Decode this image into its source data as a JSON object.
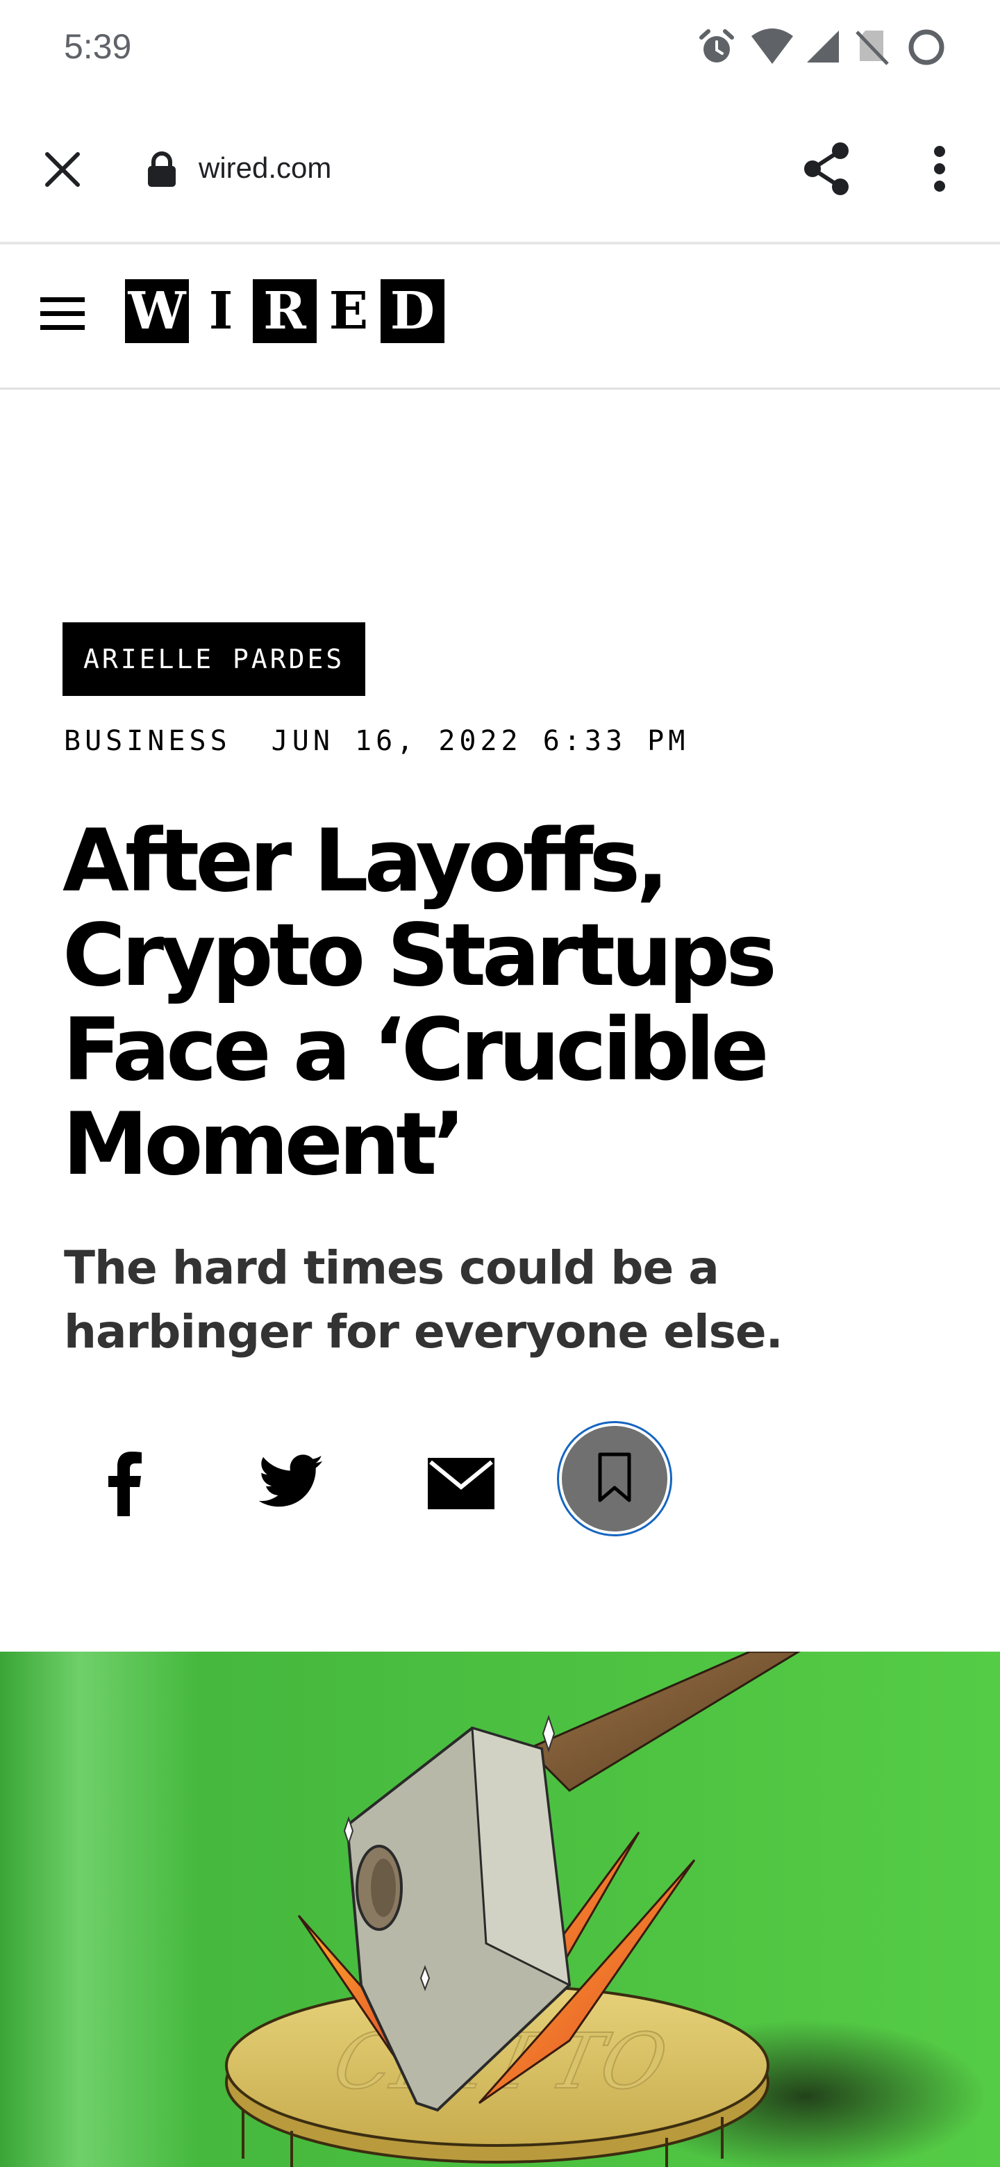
{
  "status_bar": {
    "time": "5:39",
    "icons": [
      "alarm-icon",
      "wifi-icon",
      "signal-icon",
      "no-sim-icon",
      "loading-circle-icon"
    ]
  },
  "browser": {
    "url": "wired.com",
    "icons": [
      "close-icon",
      "lock-icon",
      "share-icon",
      "more-vert-icon"
    ]
  },
  "site_nav": {
    "menu_icon": "hamburger-menu-icon",
    "logo_letters": [
      "W",
      "I",
      "R",
      "E",
      "D"
    ]
  },
  "article": {
    "author": "ARIELLE PARDES",
    "section": "BUSINESS",
    "date": "JUN 16, 2022 6:33 PM",
    "headline": "After Layoffs, Crypto Startups Face a ‘Crucible Moment’",
    "dek": "The hard times could be a harbinger for everyone else.",
    "hero_coin_text": "CRYPTO"
  },
  "share_icons": [
    "facebook-icon",
    "twitter-icon",
    "email-icon",
    "bookmark-icon"
  ],
  "colors": {
    "hero_green": "#4fc73e",
    "save_ring": "#1565c0",
    "save_fill": "#707070",
    "status_gray": "#5f6368"
  }
}
